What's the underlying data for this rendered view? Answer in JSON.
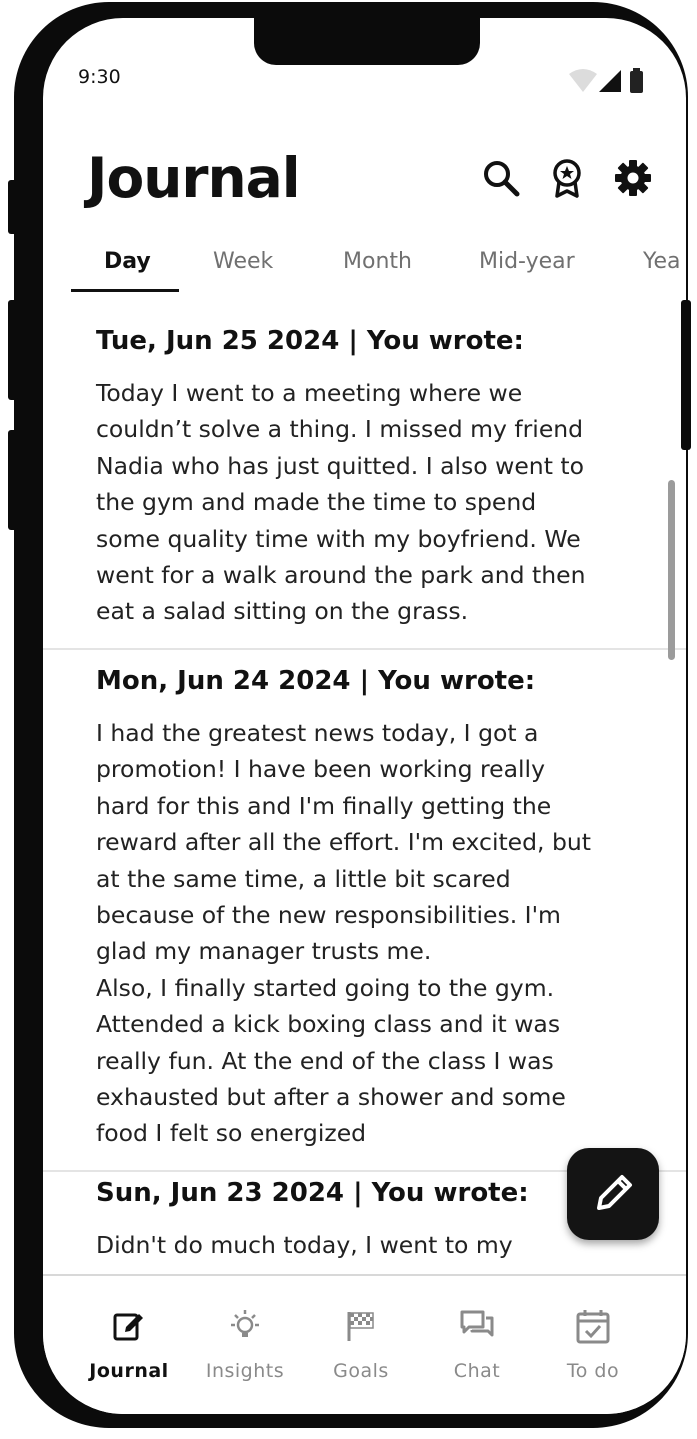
{
  "status_bar": {
    "time": "9:30"
  },
  "header": {
    "title": "Journal",
    "icons": [
      "search-icon",
      "badge-icon",
      "gear-icon"
    ]
  },
  "tabs": [
    {
      "label": "Day",
      "active": true
    },
    {
      "label": "Week",
      "active": false
    },
    {
      "label": "Month",
      "active": false
    },
    {
      "label": "Mid-year",
      "active": false
    },
    {
      "label": "Yea",
      "active": false
    }
  ],
  "entries": [
    {
      "heading": "Tue, Jun 25 2024 | You wrote:",
      "body": "Today I went to a meeting where we\ncouldn’t solve a thing. I missed my friend\nNadia who has just quitted. I also went to\nthe gym and made the time to spend\nsome quality time with my boyfriend. We\nwent for a walk around the park and then\neat a salad sitting on the grass."
    },
    {
      "heading": "Mon, Jun 24 2024 | You wrote:",
      "body": "I had the greatest news today, I got a\npromotion! I have been working really\nhard for this and I'm finally getting the\nreward after all the effort. I'm excited, but\nat the same time, a little bit scared\nbecause of the new responsibilities. I'm\nglad my manager trusts me.\nAlso, I finally started going to the gym.\nAttended a kick boxing class and it was\nreally fun. At the end of the class I was\nexhausted but after a shower and some\nfood I felt so energized"
    },
    {
      "heading": "Sun, Jun 23 2024 | You wrote:",
      "body": "Didn't do much today, I went to my"
    }
  ],
  "fab": {
    "icon": "pencil-icon"
  },
  "bottom_nav": [
    {
      "label": "Journal",
      "icon": "journal-edit-icon",
      "active": true
    },
    {
      "label": "Insights",
      "icon": "lightbulb-icon",
      "active": false
    },
    {
      "label": "Goals",
      "icon": "checkered-flag-icon",
      "active": false
    },
    {
      "label": "Chat",
      "icon": "chat-icon",
      "active": false
    },
    {
      "label": "To do",
      "icon": "calendar-check-icon",
      "active": false
    }
  ],
  "colors": {
    "primary": "#111111",
    "inactive": "#8a8a8a",
    "divider": "#e4e4e4",
    "fab": "#141414"
  }
}
